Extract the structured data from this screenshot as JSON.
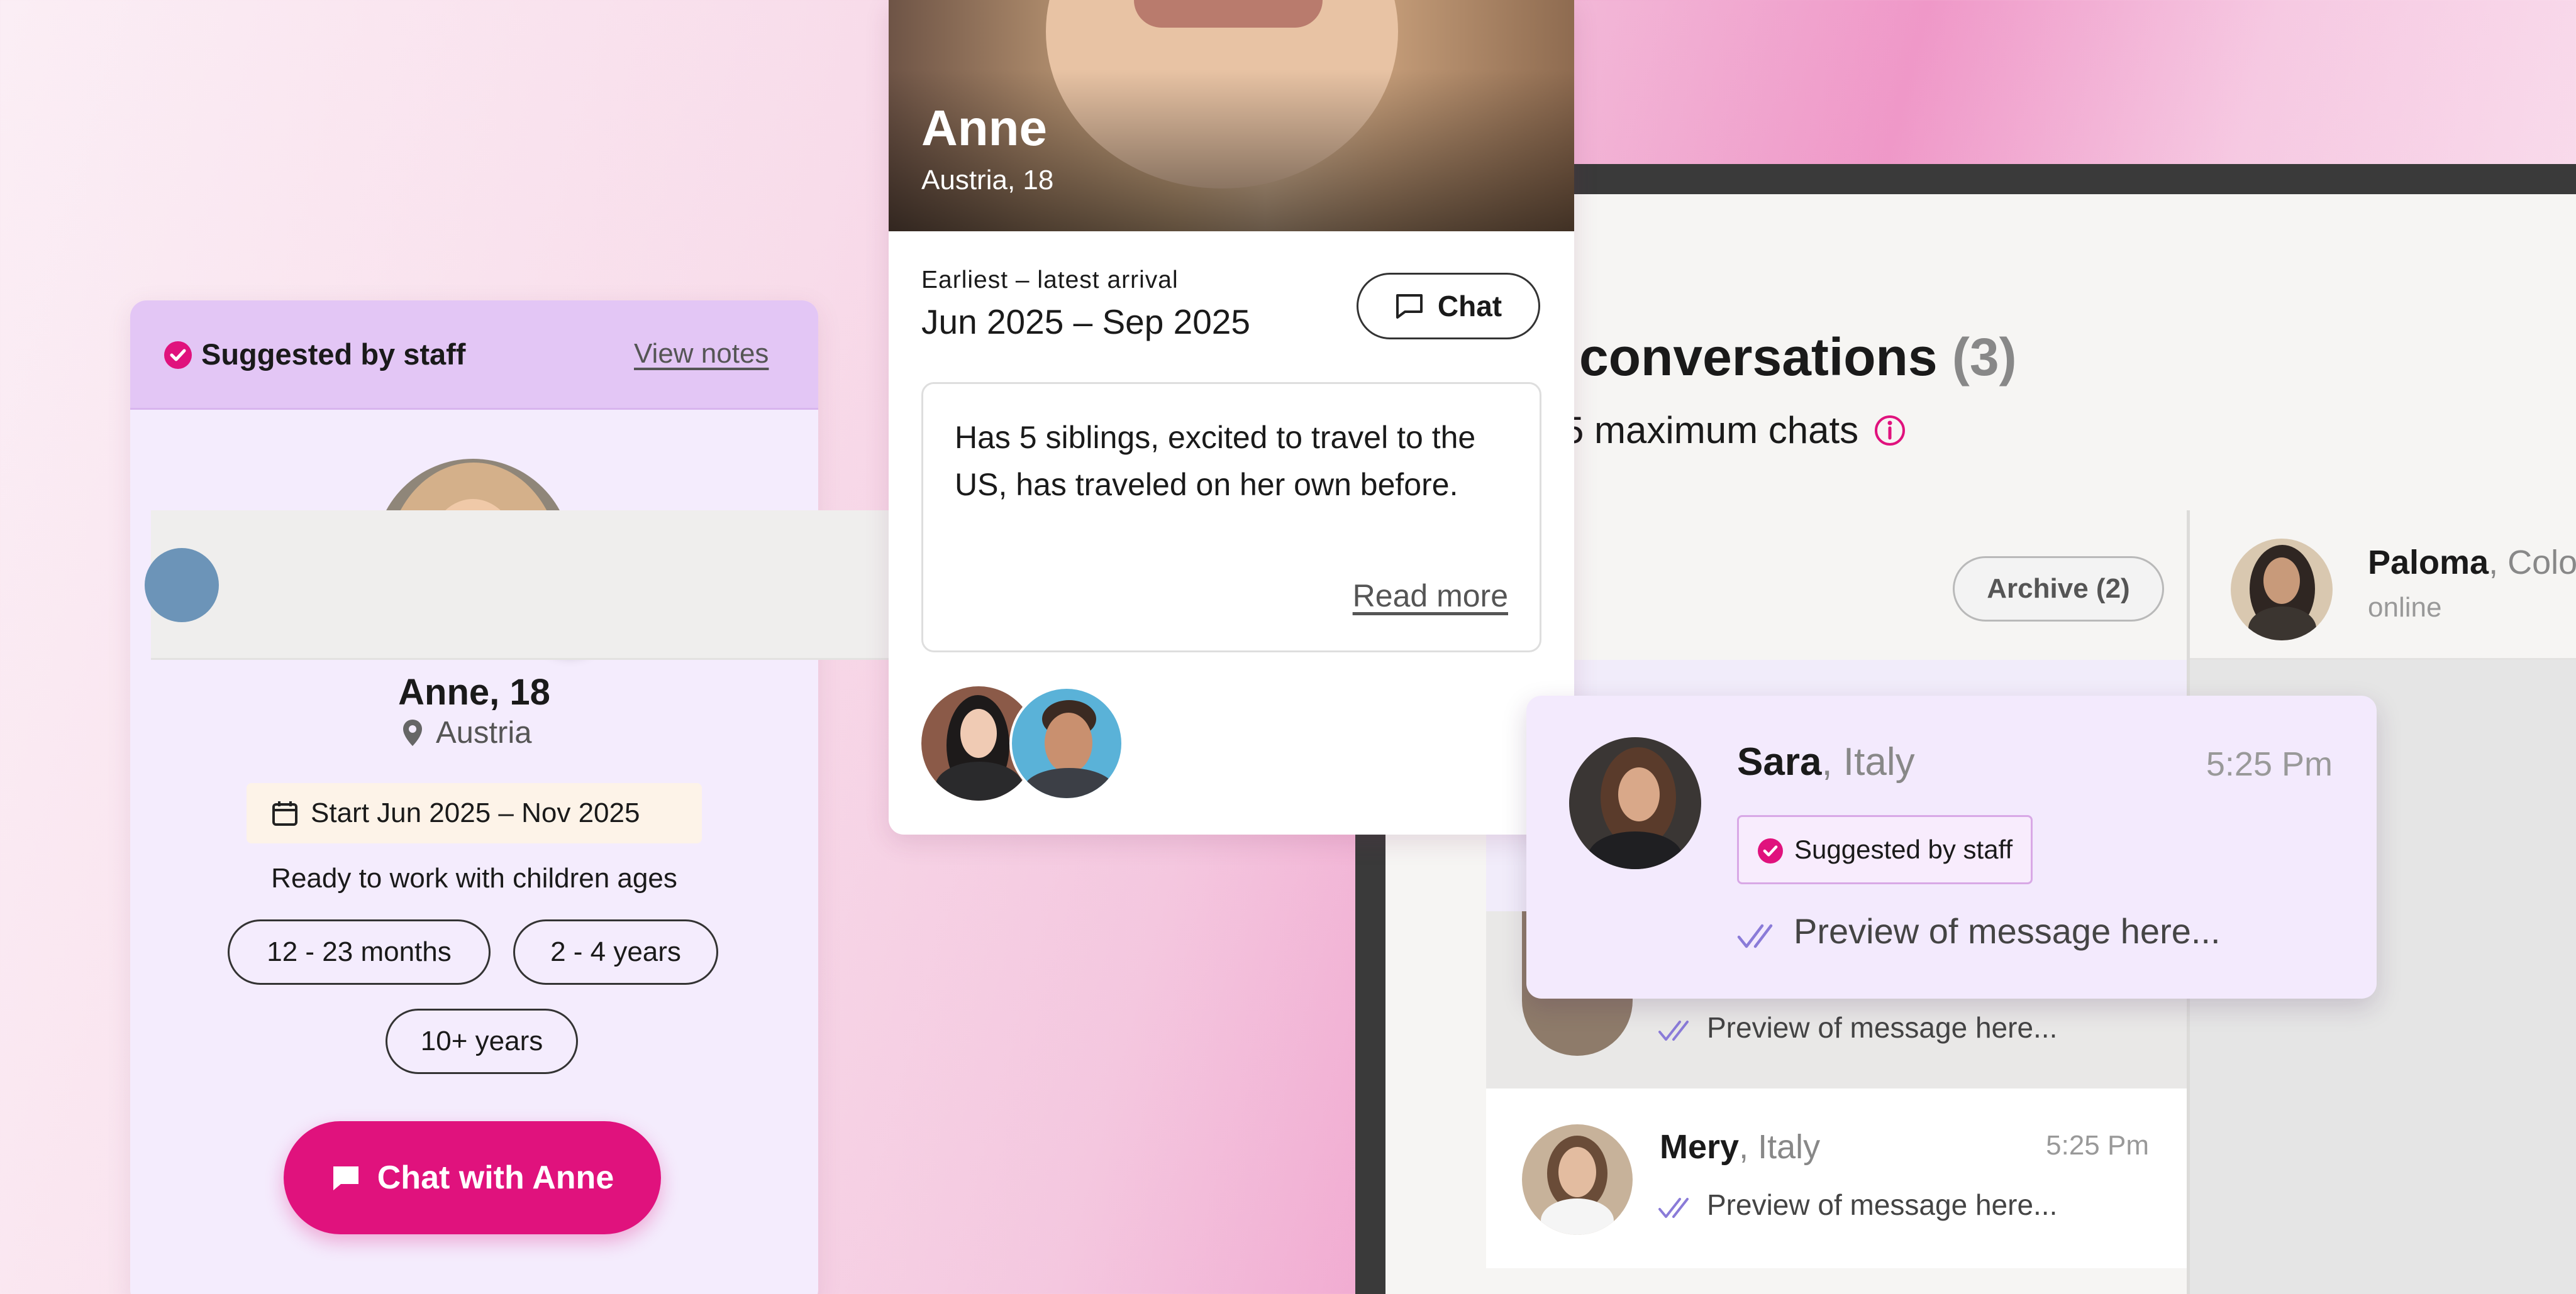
{
  "left_card": {
    "badge_label": "Suggested by staff",
    "view_notes": "View notes",
    "name": "Anne, 18",
    "location": "Austria",
    "dates": "Start Jun 2025 – Nov 2025",
    "ready_label": "Ready to work with children ages",
    "age_pills": [
      "12 - 23 months",
      "2 - 4 years",
      "10+ years"
    ],
    "chat_button": "Chat with Anne"
  },
  "mid_card": {
    "name": "Anne",
    "subtitle": "Austria, 18",
    "arrival_label": "Earliest – latest arrival",
    "arrival_value": "Jun 2025 – Sep 2025",
    "chat_button": "Chat",
    "description": "Has 5 siblings, excited to travel to the US, has traveled on her own before.",
    "read_more": "Read more"
  },
  "conversations": {
    "title": "r conversations",
    "count": "(3)",
    "subtitle": "5 maximum chats",
    "archive_button": "Archive (2)",
    "active_chat": {
      "name": "Paloma",
      "country_partial": ", Colo",
      "status": "online"
    },
    "rows": [
      {
        "preview": "Preview of message here..."
      },
      {
        "name": "Mery",
        "country": ", Italy",
        "time": "5:25 Pm",
        "preview": "Preview of message here..."
      }
    ]
  },
  "sara_card": {
    "name": "Sara",
    "country": ", Italy",
    "time": "5:25 Pm",
    "badge_label": "Suggested by staff",
    "preview": "Preview of message here..."
  },
  "colors": {
    "accent": "#e0127d",
    "staff_header": "#e3c6f5",
    "card_bg": "#f4ecfd",
    "check_purple": "#8a7bd8"
  },
  "icons": [
    "verified-badge-icon",
    "bookmark-icon",
    "location-pin-icon",
    "calendar-icon",
    "chat-bubble-icon",
    "info-icon",
    "double-check-icon"
  ]
}
